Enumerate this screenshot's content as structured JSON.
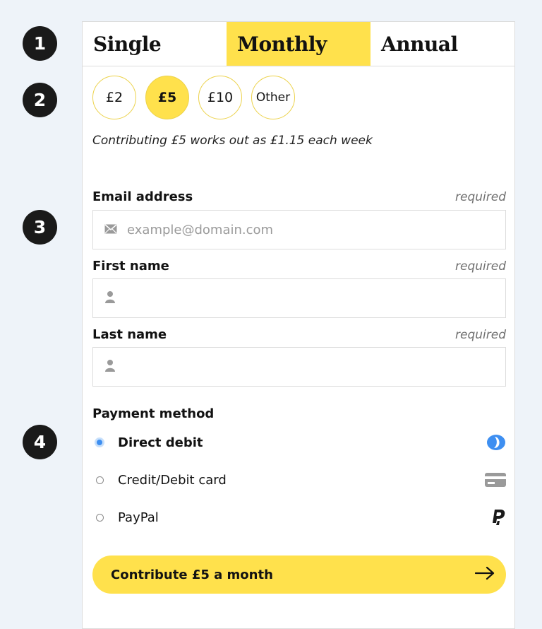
{
  "steps": [
    "1",
    "2",
    "3",
    "4"
  ],
  "tabs": [
    {
      "label": "Single",
      "active": false
    },
    {
      "label": "Monthly",
      "active": true
    },
    {
      "label": "Annual",
      "active": false
    }
  ],
  "amounts": [
    {
      "label": "£2",
      "selected": false
    },
    {
      "label": "£5",
      "selected": true
    },
    {
      "label": "£10",
      "selected": false
    },
    {
      "label": "Other",
      "selected": false
    }
  ],
  "note": "Contributing £5 works out as £1.15 each week",
  "form": {
    "email": {
      "label": "Email address",
      "required": "required",
      "placeholder": "example@domain.com",
      "icon": "envelope-icon"
    },
    "first_name": {
      "label": "First name",
      "required": "required",
      "placeholder": "",
      "icon": "person-icon"
    },
    "last_name": {
      "label": "Last name",
      "required": "required",
      "placeholder": "",
      "icon": "person-icon"
    }
  },
  "payment": {
    "title": "Payment method",
    "options": [
      {
        "label": "Direct debit",
        "selected": true,
        "icon": "direct-debit-icon"
      },
      {
        "label": "Credit/Debit card",
        "selected": false,
        "icon": "credit-card-icon"
      },
      {
        "label": "PayPal",
        "selected": false,
        "icon": "paypal-icon"
      }
    ]
  },
  "cta": {
    "label": "Contribute £5 a month",
    "icon": "arrow-right-icon"
  },
  "colors": {
    "accent": "#ffe14c",
    "background": "#eef3f9",
    "radio_selected": "#3e8ff1",
    "direct_debit_blue": "#3e8ff1"
  }
}
